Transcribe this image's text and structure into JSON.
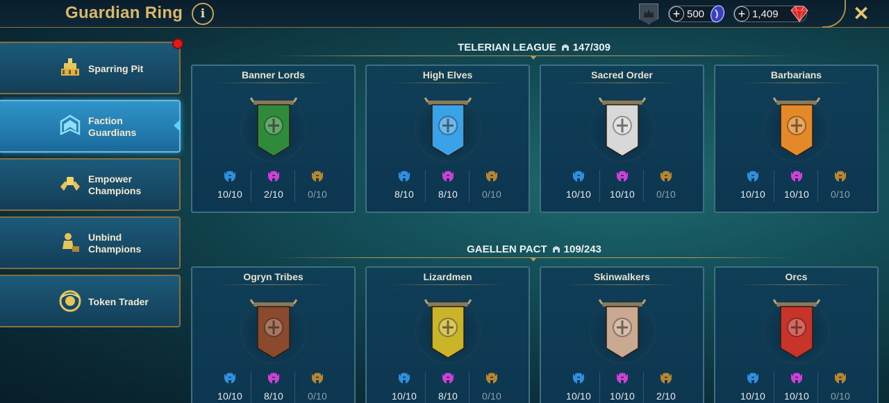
{
  "header": {
    "title": "Guardian Ring",
    "info_label": "i",
    "resources": [
      {
        "name": "energy",
        "value": "500",
        "icon": "energy-gem-icon"
      },
      {
        "name": "gems",
        "value": "1,409",
        "icon": "ruby-gem-icon"
      }
    ],
    "close_label": "✕"
  },
  "sidebar": {
    "items": [
      {
        "label": "Sparring Pit",
        "icon": "sparring-pit-icon",
        "active": false,
        "notification": true
      },
      {
        "label": "Faction Guardians",
        "icon": "faction-guardians-icon",
        "active": true
      },
      {
        "label": "Empower Champions",
        "icon": "empower-champions-icon",
        "active": false
      },
      {
        "label": "Unbind Champions",
        "icon": "unbind-champions-icon",
        "active": false
      },
      {
        "label": "Token Trader",
        "icon": "token-trader-icon",
        "active": false
      }
    ]
  },
  "leagues": [
    {
      "name": "TELERIAN LEAGUE",
      "progress": "147/309",
      "factions": [
        {
          "name": "Banner Lords",
          "rare": "10/10",
          "epic": "2/10",
          "legendary": "0/10",
          "banner_color": "#2f8a3c"
        },
        {
          "name": "High Elves",
          "rare": "8/10",
          "epic": "8/10",
          "legendary": "0/10",
          "banner_color": "#3aa2e8"
        },
        {
          "name": "Sacred Order",
          "rare": "10/10",
          "epic": "10/10",
          "legendary": "0/10",
          "banner_color": "#d8d8d8"
        },
        {
          "name": "Barbarians",
          "rare": "10/10",
          "epic": "10/10",
          "legendary": "0/10",
          "banner_color": "#e3892a"
        }
      ]
    },
    {
      "name": "GAELLEN PACT",
      "progress": "109/243",
      "factions": [
        {
          "name": "Ogryn Tribes",
          "rare": "10/10",
          "epic": "8/10",
          "legendary": "0/10",
          "banner_color": "#8a4a2e"
        },
        {
          "name": "Lizardmen",
          "rare": "10/10",
          "epic": "8/10",
          "legendary": "0/10",
          "banner_color": "#c9b42a"
        },
        {
          "name": "Skinwalkers",
          "rare": "10/10",
          "epic": "10/10",
          "legendary": "2/10",
          "banner_color": "#c9a991"
        },
        {
          "name": "Orcs",
          "rare": "10/10",
          "epic": "10/10",
          "legendary": "0/10",
          "banner_color": "#c8342a"
        }
      ]
    }
  ],
  "colors": {
    "rare": "#2f8fe0",
    "epic": "#d03fd6",
    "legendary": "#b8862e",
    "gold": "#d9b86a"
  }
}
